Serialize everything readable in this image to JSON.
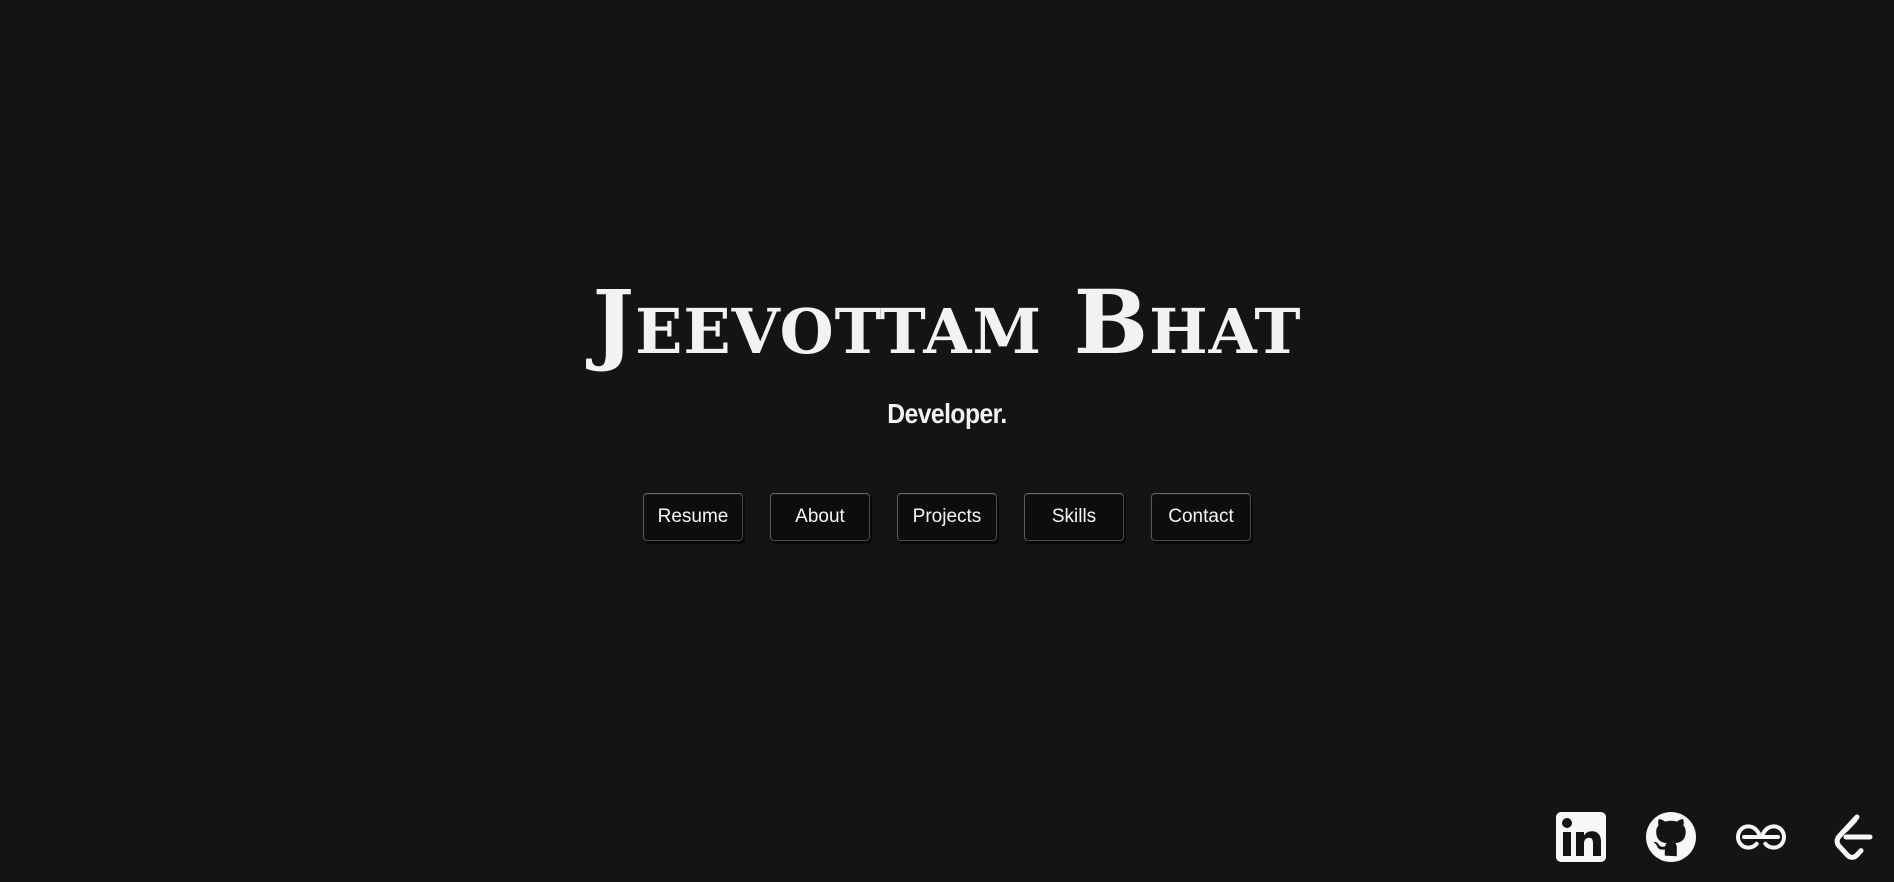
{
  "hero": {
    "title": "Jeevottam Bhat",
    "subtitle": "Developer."
  },
  "nav": {
    "items": [
      {
        "label": "Resume"
      },
      {
        "label": "About"
      },
      {
        "label": "Projects"
      },
      {
        "label": "Skills"
      },
      {
        "label": "Contact"
      }
    ]
  },
  "social": {
    "items": [
      {
        "icon": "linkedin-icon"
      },
      {
        "icon": "github-icon"
      },
      {
        "icon": "geeksforgeeks-icon"
      },
      {
        "icon": "leetcode-icon"
      }
    ]
  },
  "colors": {
    "background": "#151314",
    "text": "#f2f2f2",
    "button_background": "#0d0d0d",
    "button_border": "#4a4a4a"
  }
}
